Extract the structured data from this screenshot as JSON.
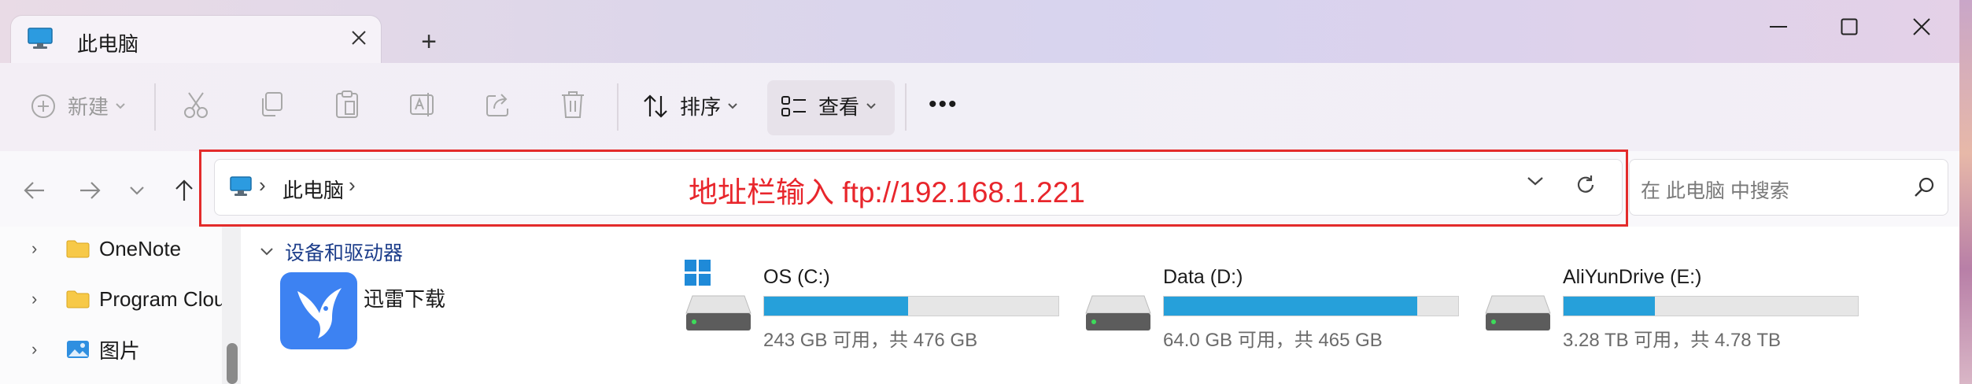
{
  "window": {
    "tab_title": "此电脑",
    "tab_close_icon": "close-icon",
    "new_tab_symbol": "+",
    "controls": [
      "minimize-icon",
      "maximize-icon",
      "close-icon"
    ]
  },
  "toolbar": {
    "new_label": "新建",
    "sort_label": "排序",
    "view_label": "查看",
    "more_symbol": "•••",
    "icons": [
      "cut-icon",
      "copy-icon",
      "paste-icon",
      "rename-icon",
      "share-icon",
      "delete-icon"
    ]
  },
  "nav": {
    "breadcrumb": "此电脑",
    "chevron": "›",
    "search_placeholder": "在 此电脑 中搜索"
  },
  "annotation": {
    "text": "地址栏输入 ftp://192.168.1.221",
    "color": "#e8262c"
  },
  "sidebar": {
    "items": [
      {
        "label": "OneNote"
      },
      {
        "label": "Program Clou"
      },
      {
        "label": "图片"
      }
    ]
  },
  "main": {
    "group_title": "设备和驱动器",
    "app": {
      "label": "迅雷下载"
    },
    "drives": [
      {
        "name": "OS (C:)",
        "usage_text": "243 GB 可用，共 476 GB",
        "used_fraction": 0.49
      },
      {
        "name": "Data (D:)",
        "usage_text": "64.0 GB 可用，共 465 GB",
        "used_fraction": 0.86
      },
      {
        "name": "AliYunDrive (E:)",
        "usage_text": "3.28 TB 可用，共 4.78 TB",
        "used_fraction": 0.31
      }
    ]
  },
  "colors": {
    "accent": "#26a0da",
    "annotation_border": "#e32b2b",
    "app_tile": "#3d82f2"
  }
}
